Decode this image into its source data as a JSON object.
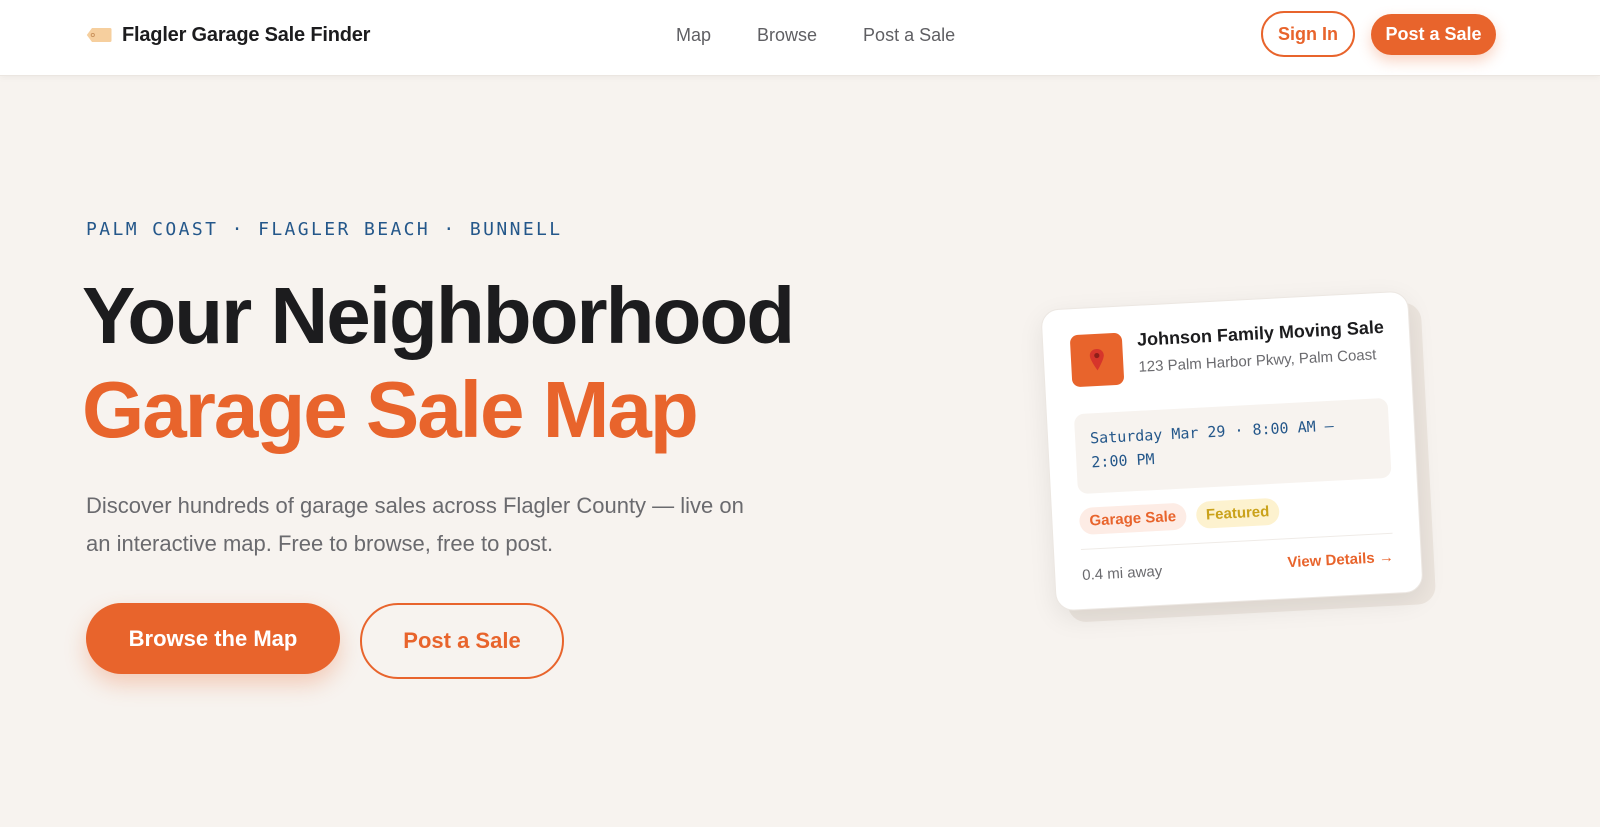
{
  "header": {
    "brand_name": "Flagler Garage Sale Finder",
    "brand_icon": "price-tag-icon",
    "nav": [
      {
        "label": "Map"
      },
      {
        "label": "Browse"
      },
      {
        "label": "Post a Sale"
      }
    ],
    "sign_in_label": "Sign In",
    "post_label": "Post a Sale"
  },
  "hero": {
    "eyebrow": "PALM COAST · FLAGLER BEACH · BUNNELL",
    "title_line1": "Your Neighborhood",
    "title_line2": "Garage Sale Map",
    "lead": "Discover hundreds of garage sales across Flagler County — live on an interactive map. Free to browse, free to post.",
    "primary_cta": "Browse the Map",
    "secondary_cta": "Post a Sale"
  },
  "card": {
    "icon": "map-pin-icon",
    "title": "Johnson Family Moving Sale",
    "address": "123 Palm Harbor Pkwy, Palm Coast",
    "time": "Saturday Mar 29 · 8:00 AM – 2:00 PM",
    "badges": [
      "Garage Sale",
      "Featured"
    ],
    "distance": "0.4 mi away",
    "link_label": "View Details →"
  },
  "colors": {
    "accent": "#e8642c",
    "eyebrow": "#24578a",
    "background": "#f7f3ef",
    "featured": "#caa21b"
  }
}
